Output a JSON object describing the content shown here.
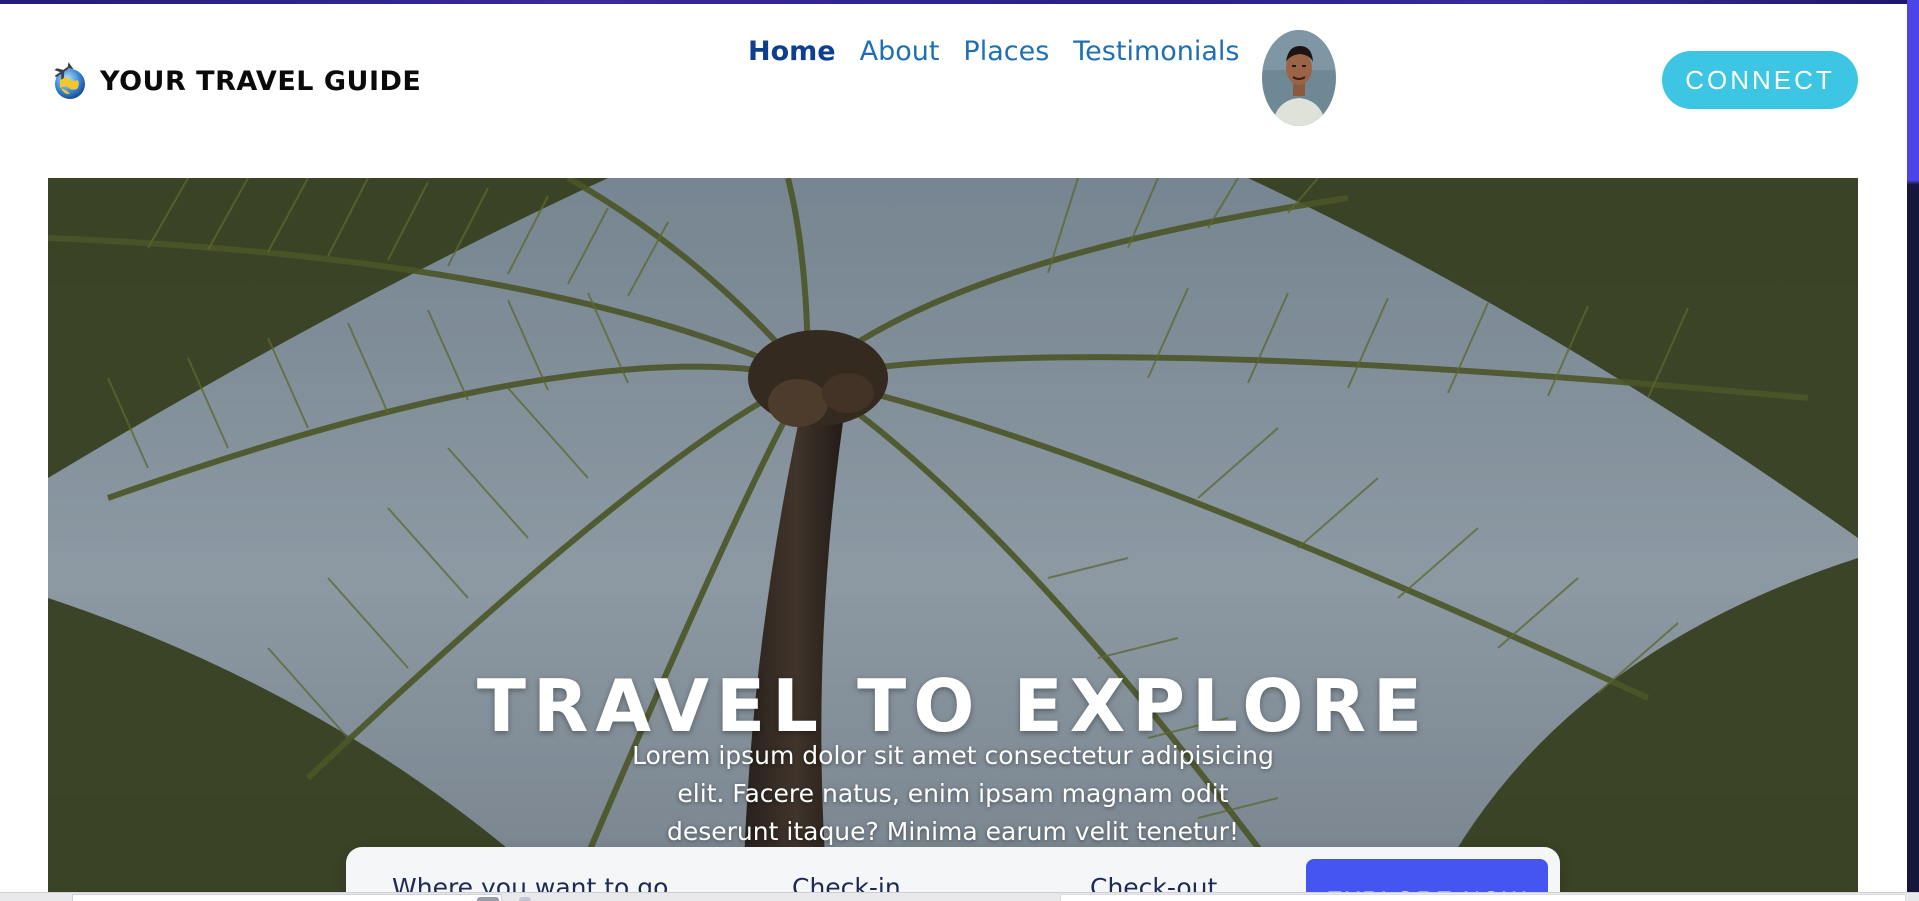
{
  "brand": {
    "title": "YOUR TRAVEL GUIDE",
    "icon": "globe-airplane-icon"
  },
  "nav": {
    "items": [
      {
        "label": "Home",
        "active": true
      },
      {
        "label": "About",
        "active": false
      },
      {
        "label": "Places",
        "active": false
      },
      {
        "label": "Testimonials",
        "active": false
      }
    ],
    "avatar": "profile-avatar"
  },
  "connect_label": "CONNECT",
  "hero": {
    "title": "TRAVEL TO EXPLORE",
    "text": "Lorem ipsum dolor sit amet consectetur adipisicing elit. Facere natus, enim ipsam magnam odit deserunt itaque? Minima earum velit tenetur!",
    "image": "palm-tree-photo"
  },
  "search": {
    "where_placeholder": "Where you want to go",
    "checkin_placeholder": "Check-in",
    "checkout_placeholder": "Check-out",
    "explore_label": "EXPLORE NOW"
  },
  "colors": {
    "nav_link": "#1f6fb6",
    "nav_active": "#0e3f8f",
    "connect_bg": "#3cc6e3",
    "explore_bg": "#4455f2",
    "brand_text": "#0a0a0a"
  }
}
